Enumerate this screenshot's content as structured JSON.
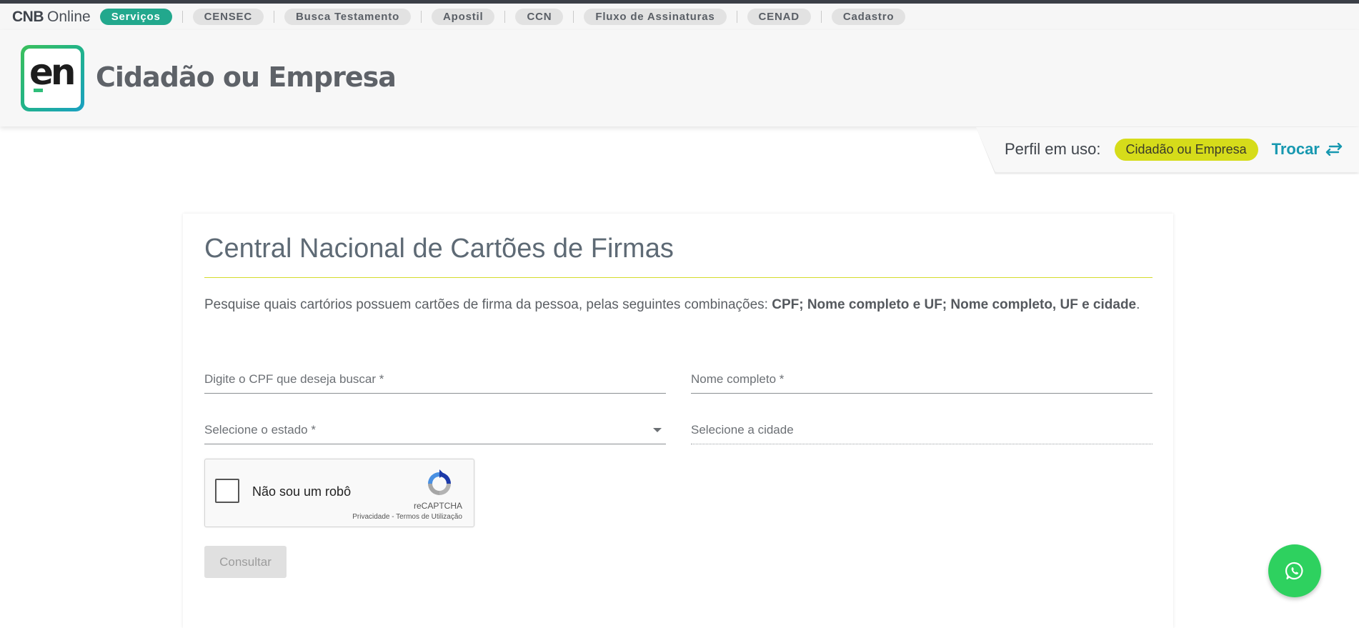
{
  "navbar": {
    "brand_bold": "CNB",
    "brand_light": "Online",
    "items": [
      {
        "label": "Serviços",
        "active": true
      },
      {
        "label": "CENSEC"
      },
      {
        "label": "Busca Testamento"
      },
      {
        "label": "Apostil"
      },
      {
        "label": "CCN"
      },
      {
        "label": "Fluxo de Assinaturas"
      },
      {
        "label": "CENAD"
      },
      {
        "label": "Cadastro"
      }
    ]
  },
  "header": {
    "logo_text": "en",
    "title": "Cidadão ou Empresa"
  },
  "profile": {
    "label": "Perfil em uso:",
    "badge": "Cidadão ou Empresa",
    "switch_label": "Trocar"
  },
  "card": {
    "title": "Central Nacional de Cartões de Firmas",
    "description_intro": "Pesquise quais cartórios possuem cartões de firma da pessoa, pelas seguintes combinações: ",
    "description_bold": "CPF; Nome completo e UF; Nome completo, UF e cidade",
    "description_end": "."
  },
  "form": {
    "cpf_label": "Digite o CPF que deseja buscar *",
    "name_label": "Nome completo *",
    "state_label": "Selecione o estado *",
    "city_label": "Selecione a cidade",
    "submit_label": "Consultar"
  },
  "captcha": {
    "label": "Não sou um robô",
    "brand": "reCAPTCHA",
    "terms": "Privacidade - Termos de Utilização"
  },
  "colors": {
    "accent_teal": "#1798b0",
    "active_pill": "#22a88d",
    "badge_yellow": "#d6dc1a",
    "whatsapp_green": "#2ed15f"
  }
}
